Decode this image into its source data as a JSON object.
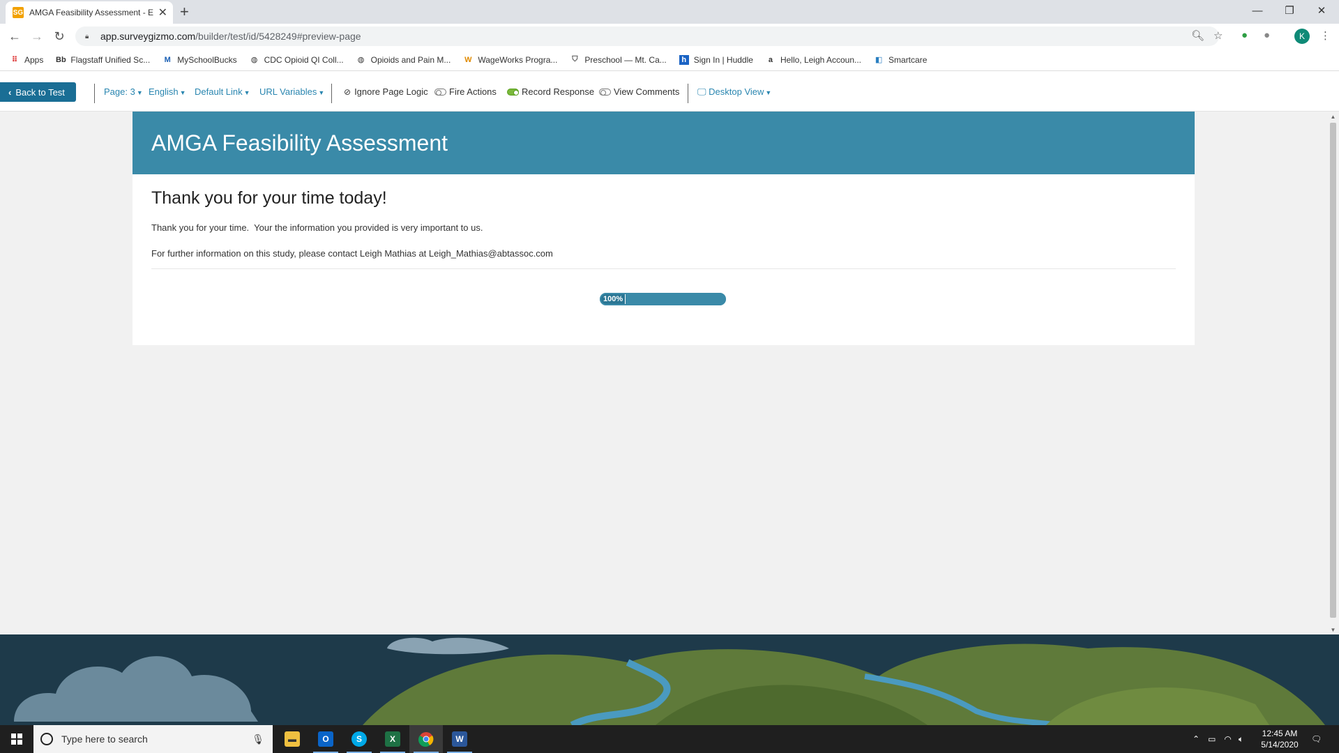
{
  "browser": {
    "tab_title": "AMGA Feasibility Assessment - E",
    "tab_favicon": "SG",
    "url_host": "app.surveygizmo.com",
    "url_path": "/builder/test/id/5428249#preview-page",
    "profile_initial": "K"
  },
  "bookmarks": [
    {
      "label": "Apps",
      "icon": "apps-grid-icon"
    },
    {
      "label": "Flagstaff Unified Sc...",
      "icon": "Bb"
    },
    {
      "label": "MySchoolBucks",
      "icon": "M"
    },
    {
      "label": "CDC Opioid QI Coll...",
      "icon": "globe-icon"
    },
    {
      "label": "Opioids and Pain M...",
      "icon": "globe-icon"
    },
    {
      "label": "WageWorks Progra...",
      "icon": "W"
    },
    {
      "label": "Preschool — Mt. Ca...",
      "icon": "shield-icon"
    },
    {
      "label": "Sign In | Huddle",
      "icon": "h"
    },
    {
      "label": "Hello, Leigh Accoun...",
      "icon": "a"
    },
    {
      "label": "Smartcare",
      "icon": "smartcare-icon"
    }
  ],
  "toolbar": {
    "back_label": "Back to Test",
    "page_label": "Page: 3",
    "language_label": "English",
    "link_label": "Default Link",
    "url_vars_label": "URL Variables",
    "ignore_logic_label": "Ignore Page Logic",
    "fire_actions_label": "Fire Actions",
    "record_response_label": "Record Response",
    "view_comments_label": "View Comments",
    "view_label": "Desktop View",
    "record_response_on": true,
    "fire_actions_on": false,
    "view_comments_on": false
  },
  "survey": {
    "title": "AMGA Feasibility Assessment",
    "heading": "Thank you for your time today!",
    "paragraph1": "Thank you for your time.  Your the information you provided is very important to us.",
    "paragraph2": "For further information on this study, please contact Leigh Mathias at Leigh_Mathias@abtassoc.com",
    "progress_label": "100%",
    "progress_percent": 100
  },
  "colors": {
    "header_bg": "#3a8aa8",
    "back_btn": "#1a6e95",
    "link": "#2a86b0"
  },
  "taskbar": {
    "search_placeholder": "Type here to search",
    "time": "12:45 AM",
    "date": "5/14/2020",
    "apps": [
      "file-explorer-icon",
      "outlook-icon",
      "skype-icon",
      "excel-icon",
      "chrome-icon",
      "word-icon"
    ]
  }
}
